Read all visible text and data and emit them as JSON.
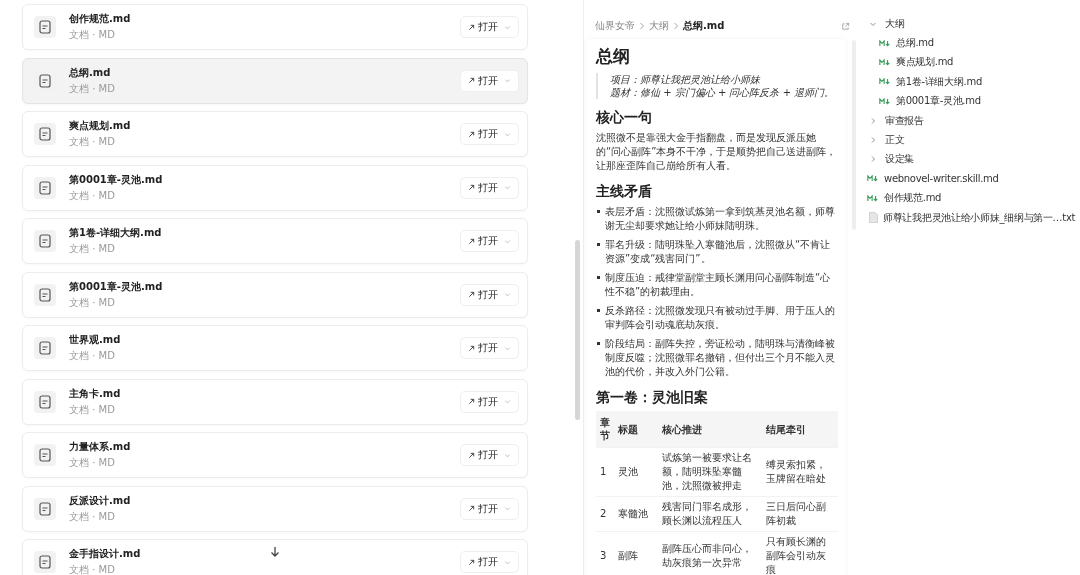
{
  "file_list": {
    "items": [
      {
        "name": "创作规范.md",
        "meta": "文档 · MD",
        "selected": false,
        "action": "打开"
      },
      {
        "name": "总纲.md",
        "meta": "文档 · MD",
        "selected": true,
        "action": "打开"
      },
      {
        "name": "爽点规划.md",
        "meta": "文档 · MD",
        "selected": false,
        "action": "打开"
      },
      {
        "name": "第0001章-灵池.md",
        "meta": "文档 · MD",
        "selected": false,
        "action": "打开"
      },
      {
        "name": "第1卷-详细大纲.md",
        "meta": "文档 · MD",
        "selected": false,
        "action": "打开"
      },
      {
        "name": "第0001章-灵池.md",
        "meta": "文档 · MD",
        "selected": false,
        "action": "打开"
      },
      {
        "name": "世界观.md",
        "meta": "文档 · MD",
        "selected": false,
        "action": "打开"
      },
      {
        "name": "主角卡.md",
        "meta": "文档 · MD",
        "selected": false,
        "action": "打开"
      },
      {
        "name": "力量体系.md",
        "meta": "文档 · MD",
        "selected": false,
        "action": "打开"
      },
      {
        "name": "反派设计.md",
        "meta": "文档 · MD",
        "selected": false,
        "action": "打开"
      },
      {
        "name": "金手指设计.md",
        "meta": "文档 · MD",
        "selected": false,
        "action": "打开"
      }
    ]
  },
  "document": {
    "breadcrumb": [
      "仙界女帝",
      "大纲",
      "总纲.md"
    ],
    "title": "总纲",
    "quote": [
      "项目：师尊让我把灵池让给小师妹",
      "题材：修仙 + 宗门偏心 + 问心阵反杀 + 退师门。"
    ],
    "sections": [
      {
        "kind": "paragraph",
        "heading": "核心一句",
        "text": "沈照微不是靠强大金手指翻盘，而是发现反派压她的“问心副阵”本身不干净，于是顺势把自己送进副阵，让那座歪阵自己崩给所有人看。"
      },
      {
        "kind": "list",
        "heading": "主线矛盾",
        "items": [
          "表层矛盾：沈照微试炼第一拿到筑基灵池名额，师尊谢无尘却要求她让给小师妹陆明珠。",
          "罪名升级：陆明珠坠入寒髓池后，沈照微从“不肯让资源”变成“残害同门”。",
          "制度压迫：戒律堂副堂主顾长渊用问心副阵制造“心性不稳”的初裁理由。",
          "反杀路径：沈照微发现只有被动过手脚、用于压人的审判阵会引动魂底劫灰痕。",
          "阶段结局：副阵失控，旁证松动，陆明珠与清衡峰被制度反噬；沈照微罪名撤销，但付出三个月不能入灵池的代价，并改入外门公籍。"
        ]
      },
      {
        "kind": "table",
        "heading": "第一卷：灵池旧案",
        "columns": [
          "章节",
          "标题",
          "核心推进",
          "结尾牵引"
        ],
        "rows": [
          [
            "1",
            "灵池",
            "试炼第一被要求让名额，陆明珠坠寒髓池，沈照微被押走",
            "缚灵索扣紧，玉牌留在暗处"
          ],
          [
            "2",
            "寒髓池",
            "残害同门罪名成形，顾长渊以流程压人",
            "三日后问心副阵初裁"
          ],
          [
            "3",
            "副阵",
            "副阵压心而非问心，劫灰痕第一次异常",
            "只有顾长渊的副阵会引动灰痕"
          ]
        ]
      }
    ]
  },
  "file_tree": {
    "items": [
      {
        "kind": "folder",
        "name": "大纲",
        "expanded": true,
        "children": [
          {
            "kind": "md",
            "name": "总纲.md"
          },
          {
            "kind": "md",
            "name": "爽点规划.md"
          },
          {
            "kind": "md",
            "name": "第1卷-详细大纲.md"
          },
          {
            "kind": "md",
            "name": "第0001章-灵池.md"
          }
        ]
      },
      {
        "kind": "folder",
        "name": "审查报告",
        "expanded": false
      },
      {
        "kind": "folder",
        "name": "正文",
        "expanded": false
      },
      {
        "kind": "folder",
        "name": "设定集",
        "expanded": false
      },
      {
        "kind": "md",
        "name": "webnovel-writer.skill.md"
      },
      {
        "kind": "md",
        "name": "创作规范.md"
      },
      {
        "kind": "txt",
        "name": "师尊让我把灵池让给小师妹_细纲与第一…txt"
      }
    ]
  }
}
